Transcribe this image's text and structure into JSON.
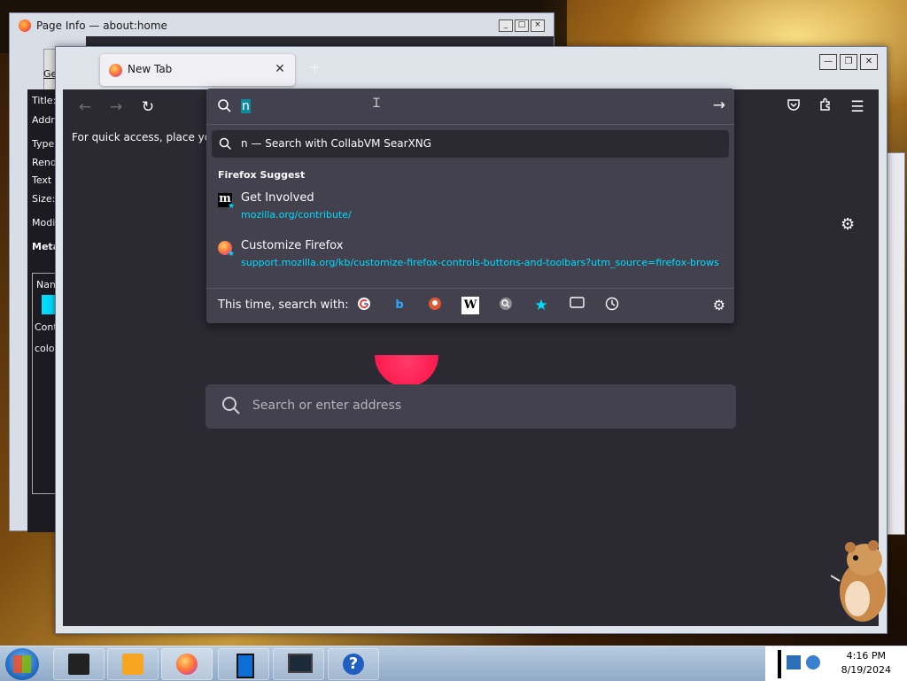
{
  "page_info_window": {
    "title": "Page Info — about:home",
    "tab_label": "Ge",
    "fields": [
      "Title:",
      "Addr",
      "Type:",
      "Rend",
      "Text E",
      "Size:",
      "Modi",
      "Meta",
      "Nam",
      "Cont",
      "colo"
    ]
  },
  "firefox": {
    "tab_title": "New Tab",
    "tab_close": "✕",
    "new_tab": "+",
    "bookmarks_hint": "For quick access, place your l",
    "search_placeholder": "Search or enter address",
    "window_controls": [
      "—",
      "❐",
      "✕"
    ]
  },
  "urlbar": {
    "value": "n",
    "search_suggestion": "n — Search with CollabVM SearXNG",
    "section_header": "Firefox Suggest",
    "results": [
      {
        "title": "Get Involved",
        "url": "mozilla.org/contribute/",
        "icon": "mozilla-m-icon"
      },
      {
        "title": "Customize Firefox",
        "url": "support.mozilla.org/kb/customize-firefox-controls-buttons-and-toolbars?utm_source=firefox-browser",
        "icon": "firefox-icon"
      }
    ],
    "engines_label": "This time, search with:",
    "engines": [
      "google-icon",
      "bing-icon",
      "duckduckgo-icon",
      "wikipedia-icon",
      "searxng-icon",
      "bookmarks-icon",
      "tabs-icon",
      "history-icon"
    ]
  },
  "taskbar": {
    "time": "4:16 PM",
    "date": "8/19/2024",
    "items": [
      "explorer-icon",
      "media-player-icon",
      "firefox-icon",
      "phone-icon",
      "monitor-icon",
      "help-icon"
    ]
  },
  "colors": {
    "accent": "#00ddff",
    "toolbar_bg": "#2b2a33",
    "panel_bg": "#42414d"
  }
}
